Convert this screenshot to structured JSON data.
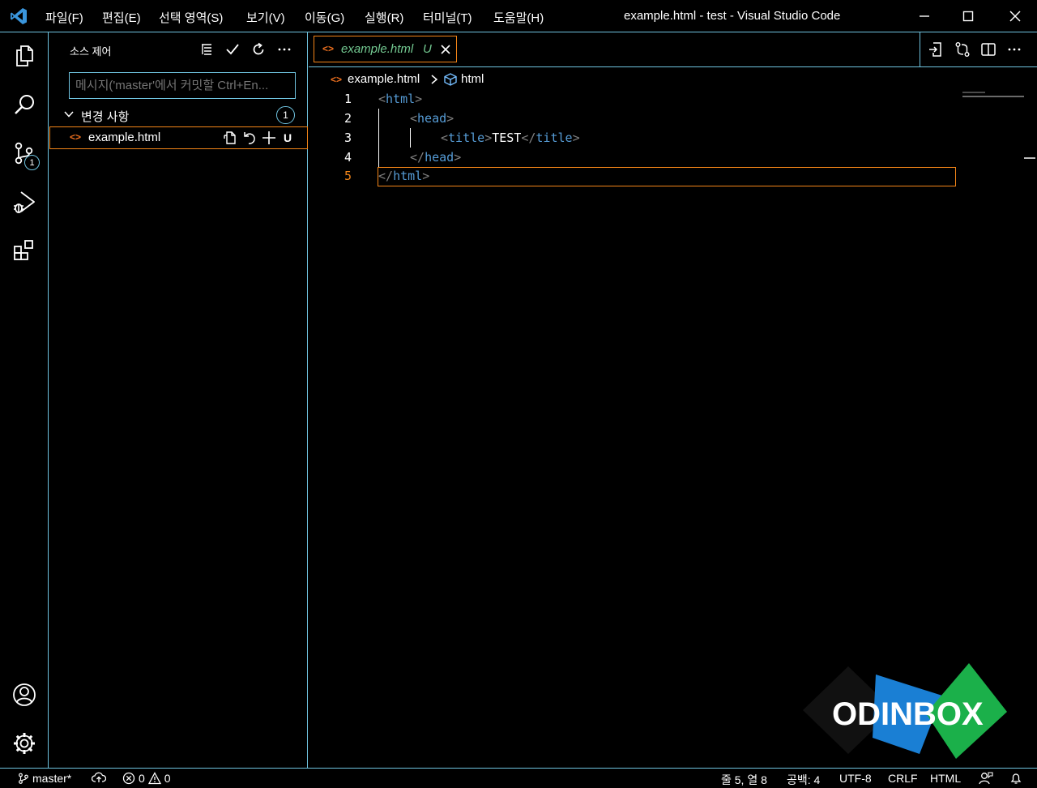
{
  "titlebar": {
    "menus": [
      "파일(F)",
      "편집(E)",
      "선택 영역(S)",
      "보기(V)",
      "이동(G)",
      "실행(R)",
      "터미널(T)",
      "도움말(H)"
    ],
    "title": "example.html - test - Visual Studio Code"
  },
  "activity": {
    "scm_badge": "1"
  },
  "sidebar": {
    "title": "소스 제어",
    "commit_placeholder": "메시지('master'에서 커밋할 Ctrl+En...",
    "changes_label": "변경 사항",
    "changes_count": "1",
    "file": {
      "name": "example.html",
      "status": "U"
    }
  },
  "editor": {
    "tab": {
      "name": "example.html",
      "status": "U"
    },
    "breadcrumb": {
      "file": "example.html",
      "symbol": "html"
    },
    "line_numbers": [
      "1",
      "2",
      "3",
      "4",
      "5"
    ],
    "code": {
      "l1_tag": "html",
      "l2_tag": "head",
      "l3_open": "title",
      "l3_text": "TEST",
      "l3_close": "title",
      "l4_tag": "head",
      "l5_tag": "html"
    }
  },
  "statusbar": {
    "branch": "master*",
    "errors": "0",
    "warnings": "0",
    "position": "줄 5, 열 8",
    "spaces": "공백: 4",
    "encoding": "UTF-8",
    "eol": "CRLF",
    "language": "HTML"
  },
  "watermark": {
    "text": "ODINBOX"
  },
  "colors": {
    "accent_border": "#6fc3df",
    "focus_border": "#f38518",
    "untracked": "#73c991",
    "tag": "#569cd6"
  }
}
